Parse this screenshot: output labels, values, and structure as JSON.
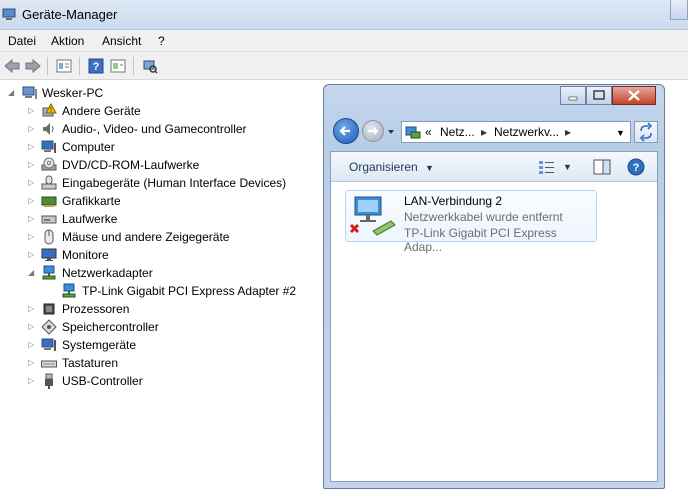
{
  "window": {
    "title": "Geräte-Manager"
  },
  "menu": [
    "Datei",
    "Aktion",
    "Ansicht",
    "?"
  ],
  "toolbar": {
    "buttons": [
      "back-icon",
      "forward-icon",
      "properties-icon",
      "help-icon",
      "show-hidden-icon",
      "scan-hardware-icon"
    ]
  },
  "tree": {
    "root": "Wesker-PC",
    "items": [
      {
        "label": "Andere Geräte",
        "icon": "warning-device-icon",
        "expanded": false
      },
      {
        "label": "Audio-, Video- und Gamecontroller",
        "icon": "speaker-icon",
        "expanded": false
      },
      {
        "label": "Computer",
        "icon": "computer-icon",
        "expanded": false
      },
      {
        "label": "DVD/CD-ROM-Laufwerke",
        "icon": "dvd-drive-icon",
        "expanded": false
      },
      {
        "label": "Eingabegeräte (Human Interface Devices)",
        "icon": "hid-icon",
        "expanded": false
      },
      {
        "label": "Grafikkarte",
        "icon": "display-adapter-icon",
        "expanded": false
      },
      {
        "label": "Laufwerke",
        "icon": "disk-drive-icon",
        "expanded": false
      },
      {
        "label": "Mäuse und andere Zeigegeräte",
        "icon": "mouse-icon",
        "expanded": false
      },
      {
        "label": "Monitore",
        "icon": "monitor-icon",
        "expanded": false
      },
      {
        "label": "Netzwerkadapter",
        "icon": "network-adapter-icon",
        "expanded": true
      },
      {
        "label": "TP-Link Gigabit PCI Express Adapter #2",
        "icon": "network-adapter-icon",
        "child": true
      },
      {
        "label": "Prozessoren",
        "icon": "processor-icon",
        "expanded": false
      },
      {
        "label": "Speichercontroller",
        "icon": "storage-controller-icon",
        "expanded": false
      },
      {
        "label": "Systemgeräte",
        "icon": "system-devices-icon",
        "expanded": false
      },
      {
        "label": "Tastaturen",
        "icon": "keyboard-icon",
        "expanded": false
      },
      {
        "label": "USB-Controller",
        "icon": "usb-icon",
        "expanded": false
      }
    ]
  },
  "explorer": {
    "breadcrumb": [
      "«",
      "Netz...",
      "Netzwerkv..."
    ],
    "organize_label": "Organisieren",
    "connection": {
      "name": "LAN-Verbindung 2",
      "status": "Netzwerkkabel wurde entfernt",
      "adapter": "TP-Link Gigabit PCI Express Adap..."
    }
  }
}
